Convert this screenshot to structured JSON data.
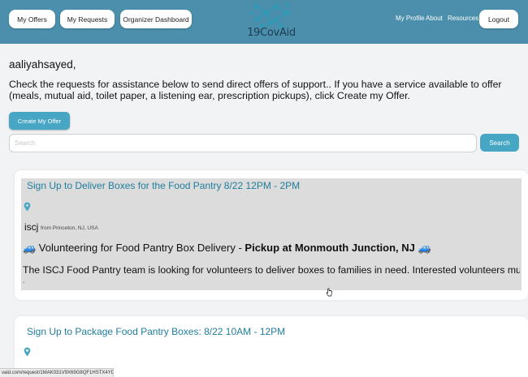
{
  "header": {
    "buttons": {
      "my_offers": "My Offers",
      "my_requests": "My Requests",
      "organizer_dashboard": "Organizer Dashboard",
      "logout": "Logout"
    },
    "logo_text": "19CovAid",
    "links": {
      "my_profile": "My Profile",
      "about": "About",
      "resources": "Resources"
    },
    "colors": {
      "bar": "#4b8fac",
      "logo": "#2f9ab5"
    }
  },
  "main": {
    "greeting": "aaliyahsayed,",
    "intro": "Check the requests for assistance below  to send direct offers of support.. If you have a service available to offer (meals, mutual aid, toilet paper, a listening ear, prescription pickups), click Create my Offer.",
    "create_offer_label": "Create My Offer",
    "search": {
      "placeholder": "Search",
      "value": "",
      "button_label": "Search"
    },
    "accent_color": "#46a6c4"
  },
  "requests": [
    {
      "title": "Sign Up to Deliver Boxes for the Food Pantry 8/22 12PM - 2PM",
      "organization": "iscj",
      "location": "from Princeton, NJ, USA",
      "headline_prefix": "🚙 Volunteering for Food Pantry Box Delivery - ",
      "headline_bold": "Pickup at Monmouth Junction, NJ 🚙",
      "description": "The ISCJ Food Pantry team is looking for volunteers to deliver boxes to families in need. Interested volunteers must",
      "truncation": "."
    },
    {
      "title": "Sign Up to Package Food Pantry Boxes: 8/22 10AM - 12PM"
    }
  ],
  "status_bar": {
    "url": "vaid.com/request/1MAK031V9X69G8QF1HSTX4YDP7"
  },
  "icons": [
    "logo-network-icon",
    "map-pin-icon",
    "mouse-pointer-icon"
  ]
}
